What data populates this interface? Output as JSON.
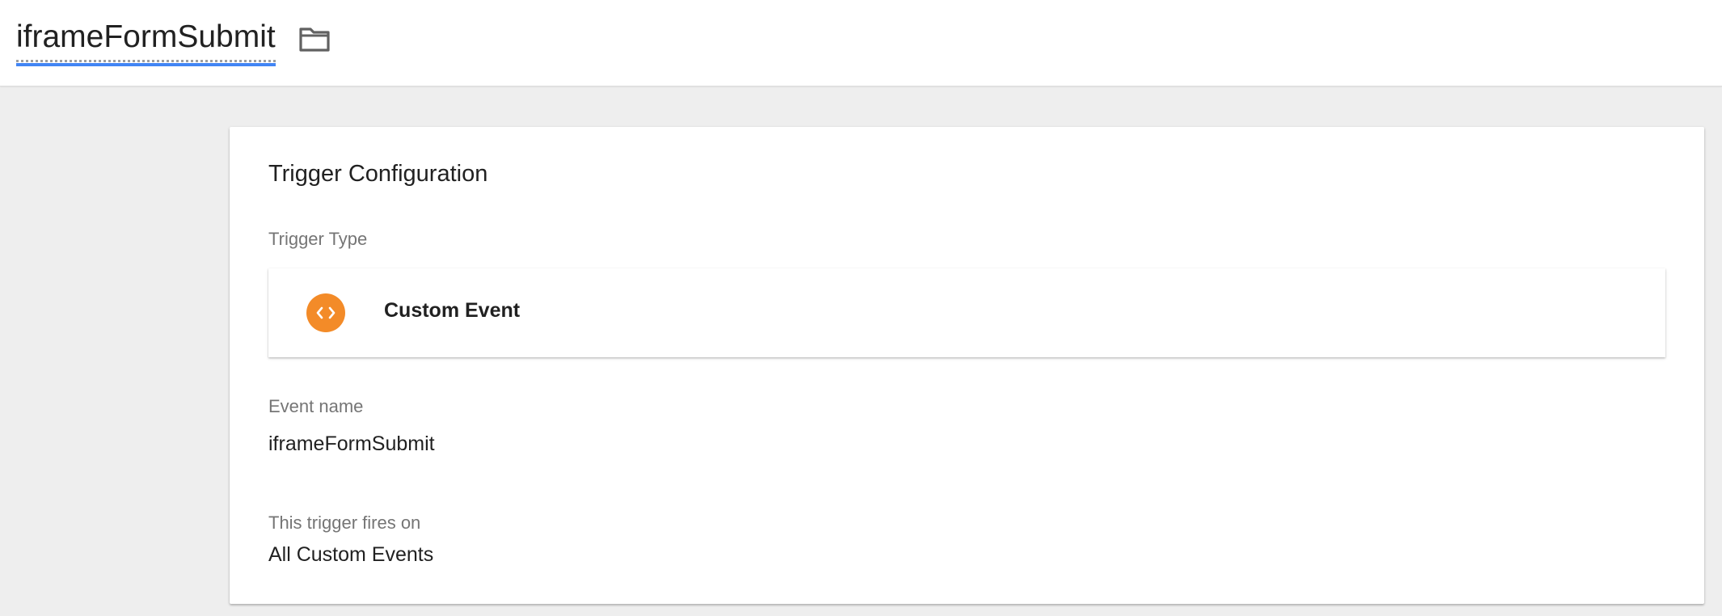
{
  "header": {
    "title": "iframeFormSubmit",
    "folder_icon": "folder-icon"
  },
  "card": {
    "title": "Trigger Configuration",
    "trigger_type": {
      "label": "Trigger Type",
      "value": "Custom Event",
      "icon": "code-icon",
      "icon_color": "#f38b28"
    },
    "event_name": {
      "label": "Event name",
      "value": "iframeFormSubmit"
    },
    "fires_on": {
      "label": "This trigger fires on",
      "value": "All Custom Events"
    }
  },
  "colors": {
    "accent_underline": "#4285f4",
    "page_background": "#eeeeee"
  }
}
